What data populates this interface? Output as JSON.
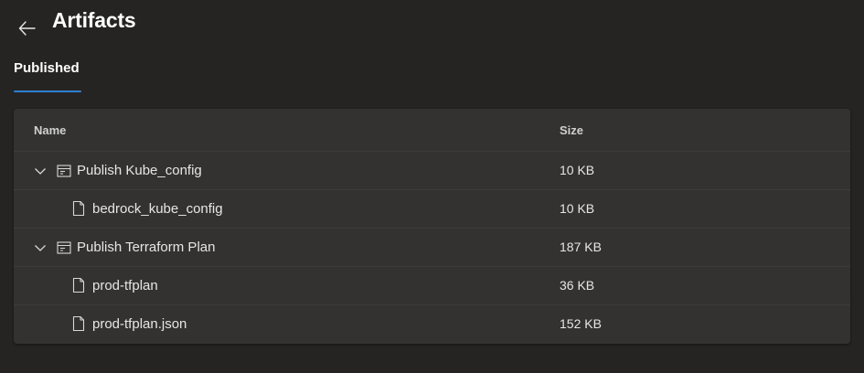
{
  "page": {
    "title": "Artifacts"
  },
  "tabs": [
    {
      "label": "Published",
      "active": true
    }
  ],
  "colors": {
    "accent": "#2f7fd1",
    "background": "#252423",
    "card": "#333231"
  },
  "table": {
    "columns": {
      "name": "Name",
      "size": "Size"
    },
    "rows": [
      {
        "type": "artifact",
        "expanded": true,
        "icon": "artifact-icon",
        "name": "Publish Kube_config",
        "size": "10 KB"
      },
      {
        "type": "file",
        "icon": "file-icon",
        "name": "bedrock_kube_config",
        "size": "10 KB"
      },
      {
        "type": "artifact",
        "expanded": true,
        "icon": "artifact-icon",
        "name": "Publish Terraform Plan",
        "size": "187 KB"
      },
      {
        "type": "file",
        "icon": "file-icon",
        "name": "prod-tfplan",
        "size": "36 KB"
      },
      {
        "type": "file",
        "icon": "file-icon",
        "name": "prod-tfplan.json",
        "size": "152 KB"
      }
    ]
  }
}
